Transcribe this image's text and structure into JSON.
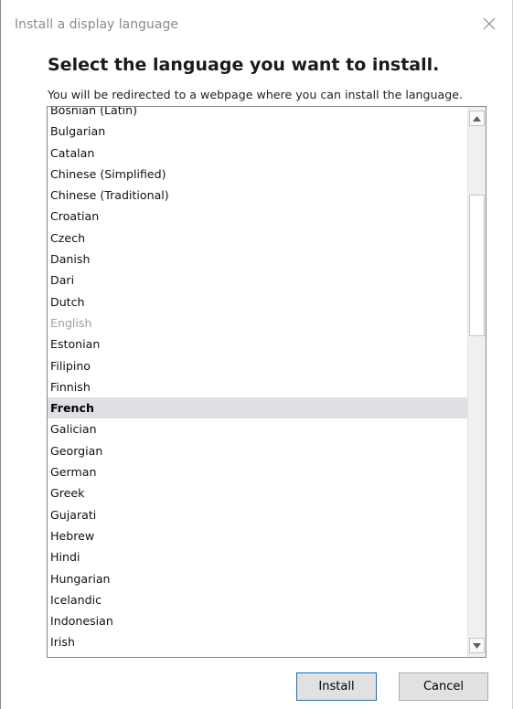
{
  "window": {
    "title": "Install a display language",
    "close_icon": "close-icon"
  },
  "main": {
    "heading": "Select the language you want to install.",
    "subtitle": "You will be redirected to a webpage where you can install the language."
  },
  "languages": [
    {
      "label": "Bosnian (Latin)",
      "state": "normal"
    },
    {
      "label": "Bulgarian",
      "state": "normal"
    },
    {
      "label": "Catalan",
      "state": "normal"
    },
    {
      "label": "Chinese (Simplified)",
      "state": "normal"
    },
    {
      "label": "Chinese (Traditional)",
      "state": "normal"
    },
    {
      "label": "Croatian",
      "state": "normal"
    },
    {
      "label": "Czech",
      "state": "normal"
    },
    {
      "label": "Danish",
      "state": "normal"
    },
    {
      "label": "Dari",
      "state": "normal"
    },
    {
      "label": "Dutch",
      "state": "normal"
    },
    {
      "label": "English",
      "state": "disabled"
    },
    {
      "label": "Estonian",
      "state": "normal"
    },
    {
      "label": "Filipino",
      "state": "normal"
    },
    {
      "label": "Finnish",
      "state": "normal"
    },
    {
      "label": "French",
      "state": "selected"
    },
    {
      "label": "Galician",
      "state": "normal"
    },
    {
      "label": "Georgian",
      "state": "normal"
    },
    {
      "label": "German",
      "state": "normal"
    },
    {
      "label": "Greek",
      "state": "normal"
    },
    {
      "label": "Gujarati",
      "state": "normal"
    },
    {
      "label": "Hebrew",
      "state": "normal"
    },
    {
      "label": "Hindi",
      "state": "normal"
    },
    {
      "label": "Hungarian",
      "state": "normal"
    },
    {
      "label": "Icelandic",
      "state": "normal"
    },
    {
      "label": "Indonesian",
      "state": "normal"
    },
    {
      "label": "Irish",
      "state": "normal"
    }
  ],
  "buttons": {
    "install_label": "Install",
    "cancel_label": "Cancel"
  },
  "colors": {
    "selected_row": "#e0dfe3",
    "disabled_text": "#a0a0a0",
    "default_button_border": "#0078d7"
  }
}
